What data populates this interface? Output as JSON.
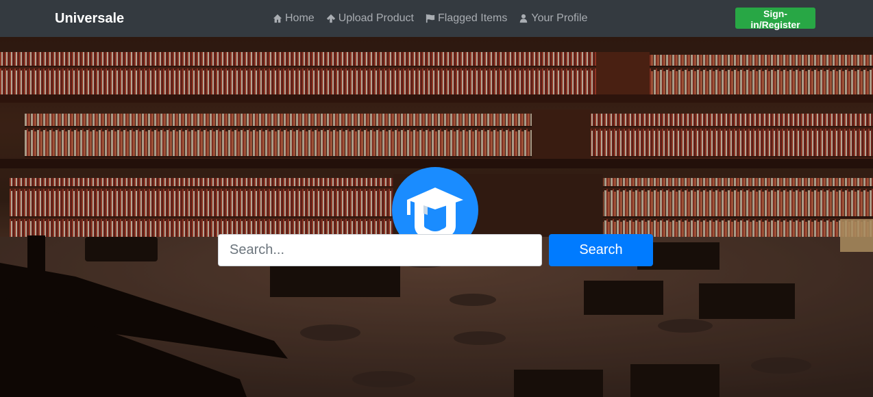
{
  "navbar": {
    "brand": "Universale",
    "links": [
      {
        "label": "Home",
        "icon": "home-icon"
      },
      {
        "label": "Upload Product",
        "icon": "arrow-up-icon"
      },
      {
        "label": "Flagged Items",
        "icon": "flag-icon"
      },
      {
        "label": "Your Profile",
        "icon": "user-icon"
      }
    ],
    "signin_label": "Sign-in/Register"
  },
  "search": {
    "placeholder": "Search...",
    "button_label": "Search"
  },
  "colors": {
    "navbar_bg": "#343a40",
    "signin_green": "#28a745",
    "primary_blue": "#007bff",
    "logo_blue": "#1a8cff"
  }
}
